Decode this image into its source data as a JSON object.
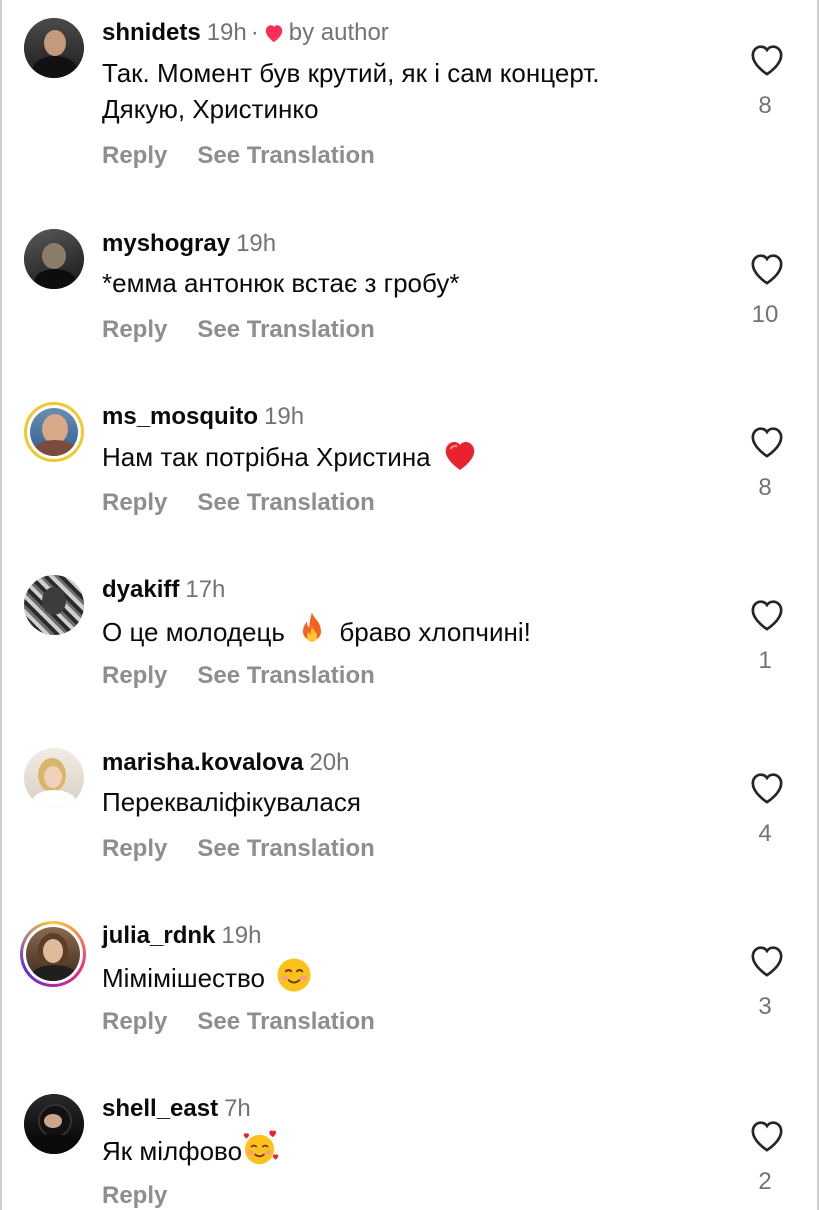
{
  "comments": [
    {
      "username": "shnidets",
      "time": "19h",
      "author_liked": true,
      "separator": "·",
      "by_author": "by author",
      "text_lines": [
        "Так. Момент був крутий, як і сам концерт.",
        "Дякую, Христинко"
      ],
      "reply": "Reply",
      "see_translation": "See Translation",
      "likes": "8"
    },
    {
      "username": "myshogray",
      "time": "19h",
      "text": "*емма антонюк встає з гробу*",
      "reply": "Reply",
      "see_translation": "See Translation",
      "likes": "10"
    },
    {
      "username": "ms_mosquito",
      "time": "19h",
      "text": "Нам так потрібна Христина",
      "emoji": "red-heart-emoji",
      "reply": "Reply",
      "see_translation": "See Translation",
      "likes": "8"
    },
    {
      "username": "dyakiff",
      "time": "17h",
      "text_before": "О це молодець",
      "emoji": "fire-emoji",
      "text_after": "браво хлопчині!",
      "reply": "Reply",
      "see_translation": "See Translation",
      "likes": "1"
    },
    {
      "username": "marisha.kovalova",
      "time": "20h",
      "text": "Перекваліфікувалася",
      "reply": "Reply",
      "see_translation": "See Translation",
      "likes": "4"
    },
    {
      "username": "julia_rdnk",
      "time": "19h",
      "text": "Мімімішество",
      "emoji": "smiling-blush-emoji",
      "reply": "Reply",
      "see_translation": "See Translation",
      "likes": "3"
    },
    {
      "username": "shell_east",
      "time": "7h",
      "text": "Як мілфово",
      "emoji": "smiling-face-with-hearts-emoji",
      "reply": "Reply",
      "likes": "2"
    }
  ],
  "colors": {
    "username": "#0a0a0a",
    "secondary": "#737373",
    "action": "#8e8e8e",
    "heart_red": "#ff2d55"
  }
}
